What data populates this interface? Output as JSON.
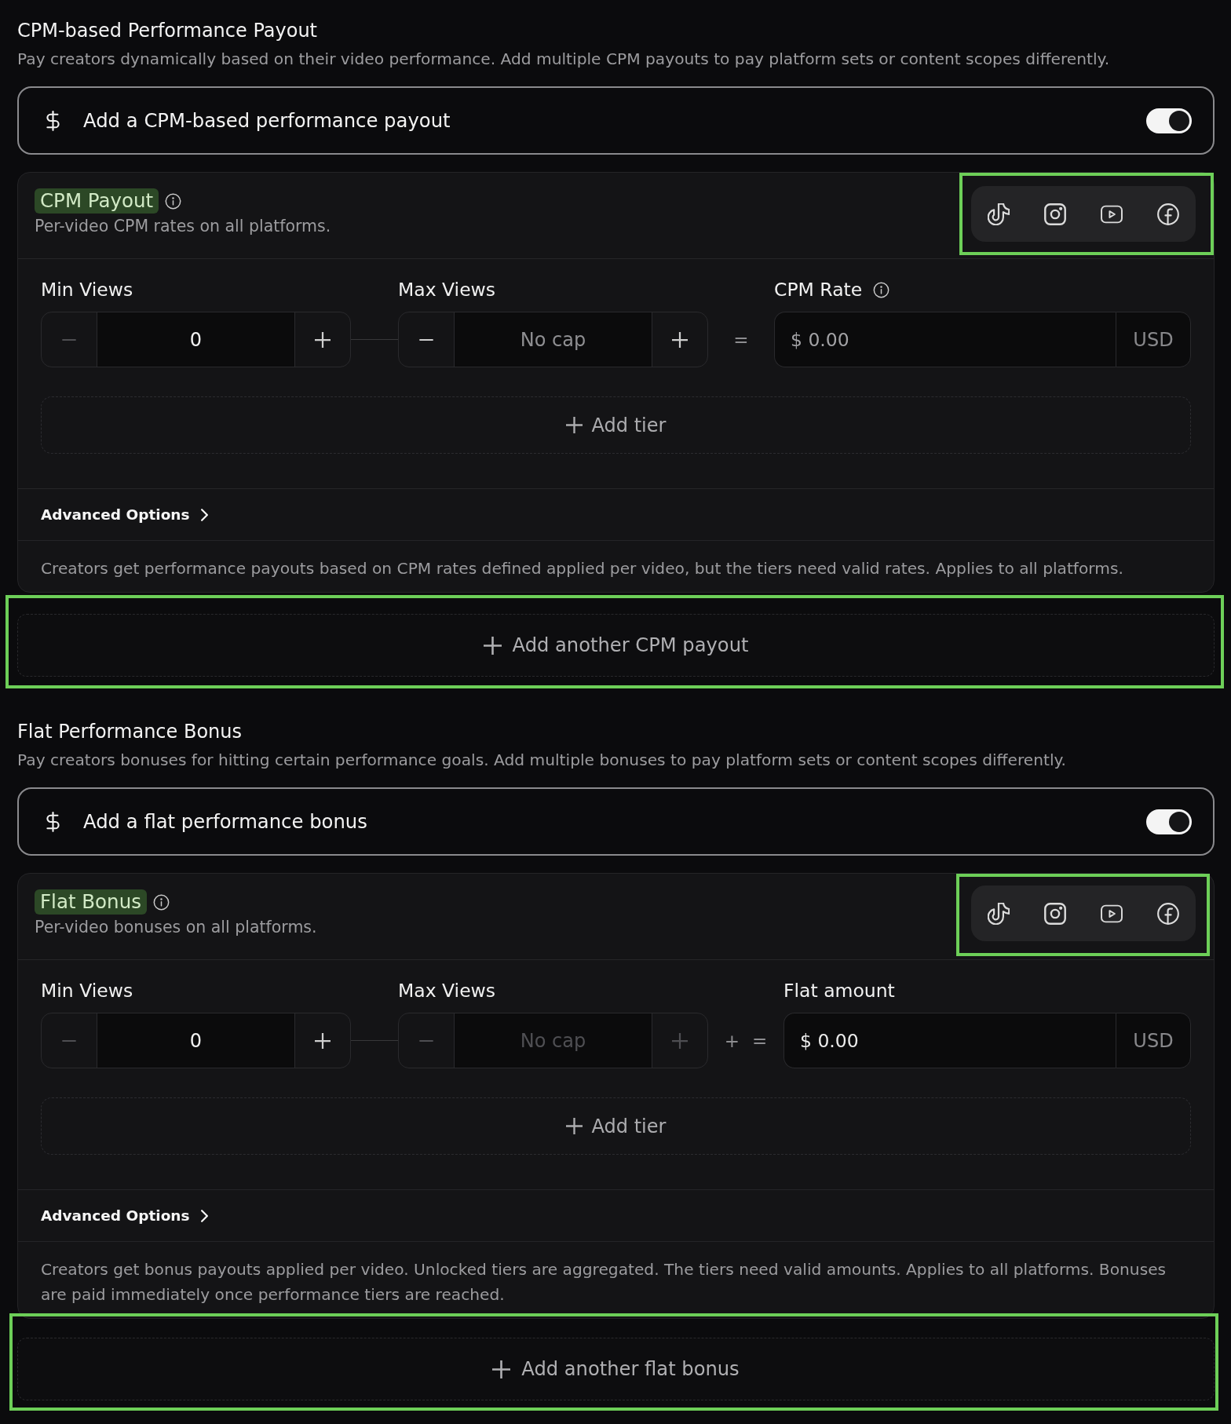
{
  "sections": [
    {
      "title": "CPM-based Performance Payout",
      "description": "Pay creators dynamically based on their video performance. Add multiple CPM payouts to pay platform sets or content scopes differently.",
      "toggle": {
        "label": "Add a CPM-based performance payout",
        "on": true
      },
      "payouts": [
        {
          "name": "CPM Payout",
          "subtitle": "Per-video CPM rates on all platforms.",
          "platforms": {
            "highlighted": true,
            "items": [
              {
                "kind": "tiktok"
              },
              {
                "kind": "instagram"
              },
              {
                "kind": "youtube"
              },
              {
                "kind": "facebook"
              }
            ]
          },
          "tiers": {
            "min": {
              "label": "Min Views",
              "value": "0",
              "minus_disabled": true,
              "disabled": false
            },
            "max": {
              "label": "Max Views",
              "placeholder": "No cap",
              "disabled": false
            },
            "operators": [
              "="
            ],
            "amount": {
              "label": "CPM Rate",
              "info": true,
              "placeholder": "$ 0.00",
              "currency": "USD"
            }
          },
          "add_tier": "Add tier",
          "advanced": {
            "label": "Advanced Options",
            "expanded": false
          },
          "note": "Creators get performance payouts based on CPM rates defined applied per video, but the tiers need valid rates. Applies to all platforms."
        }
      ],
      "add_another": {
        "label": "Add another CPM payout",
        "highlighted": true
      }
    },
    {
      "title": "Flat Performance Bonus",
      "description": "Pay creators bonuses for hitting certain performance goals. Add multiple bonuses to pay platform sets or content scopes differently.",
      "toggle": {
        "label": "Add a flat performance bonus",
        "on": true
      },
      "payouts": [
        {
          "name": "Flat Bonus",
          "subtitle": "Per-video bonuses on all platforms.",
          "platforms": {
            "highlighted": true,
            "items": [
              {
                "kind": "tiktok"
              },
              {
                "kind": "instagram"
              },
              {
                "kind": "youtube"
              },
              {
                "kind": "facebook"
              }
            ]
          },
          "tiers": {
            "min": {
              "label": "Min Views",
              "value": "0",
              "minus_disabled": true,
              "disabled": false
            },
            "max": {
              "label": "Max Views",
              "placeholder": "No cap",
              "disabled": true
            },
            "operators": [
              "+",
              "="
            ],
            "amount": {
              "label": "Flat amount",
              "info": false,
              "value": "$ 0.00",
              "currency": "USD"
            }
          },
          "add_tier": "Add tier",
          "advanced": {
            "label": "Advanced Options",
            "expanded": false
          },
          "note": "Creators get bonus payouts applied per video. Unlocked tiers are aggregated. The tiers need valid amounts. Applies to all platforms. Bonuses are paid immediately once performance tiers are reached."
        }
      ],
      "add_another": {
        "label": "Add another flat bonus",
        "highlighted": true
      }
    }
  ]
}
